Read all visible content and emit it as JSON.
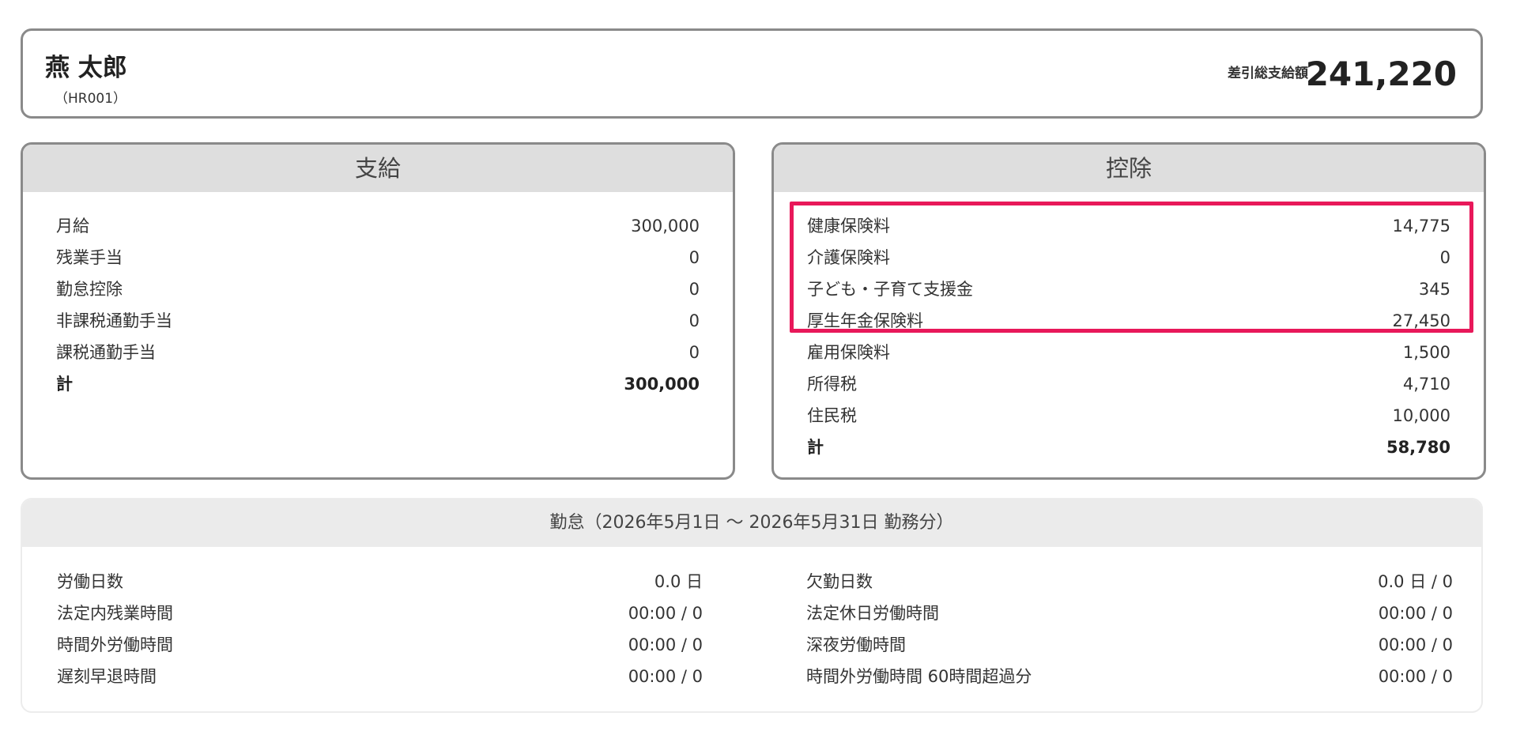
{
  "header": {
    "employee_name": "燕 太郎",
    "employee_code": "（HR001）",
    "net_pay_label": "差引総支給額",
    "net_pay_value": "241,220"
  },
  "payments": {
    "title": "支給",
    "rows": [
      {
        "label": "月給",
        "value": "300,000"
      },
      {
        "label": "残業手当",
        "value": "0"
      },
      {
        "label": "勤怠控除",
        "value": "0"
      },
      {
        "label": "非課税通勤手当",
        "value": "0"
      },
      {
        "label": "課税通勤手当",
        "value": "0"
      }
    ],
    "total_label": "計",
    "total_value": "300,000"
  },
  "deductions": {
    "title": "控除",
    "rows": [
      {
        "label": "健康保険料",
        "value": "14,775"
      },
      {
        "label": "介護保険料",
        "value": "0"
      },
      {
        "label": "子ども・子育て支援金",
        "value": "345"
      },
      {
        "label": "厚生年金保険料",
        "value": "27,450"
      },
      {
        "label": "雇用保険料",
        "value": "1,500"
      },
      {
        "label": "所得税",
        "value": "4,710"
      },
      {
        "label": "住民税",
        "value": "10,000"
      }
    ],
    "total_label": "計",
    "total_value": "58,780",
    "highlight_color": "#e8185a"
  },
  "attendance": {
    "title": "勤怠（2026年5月1日 〜 2026年5月31日 勤務分）",
    "left": [
      {
        "label": "労働日数",
        "value": "0.0 日"
      },
      {
        "label": "法定内残業時間",
        "value": "00:00 / 0"
      },
      {
        "label": "時間外労働時間",
        "value": "00:00 / 0"
      },
      {
        "label": "遅刻早退時間",
        "value": "00:00 / 0"
      }
    ],
    "right": [
      {
        "label": "欠勤日数",
        "value": "0.0 日 / 0"
      },
      {
        "label": "法定休日労働時間",
        "value": "00:00 / 0"
      },
      {
        "label": "深夜労働時間",
        "value": "00:00 / 0"
      },
      {
        "label": "時間外労働時間 60時間超過分",
        "value": "00:00 / 0"
      }
    ]
  }
}
